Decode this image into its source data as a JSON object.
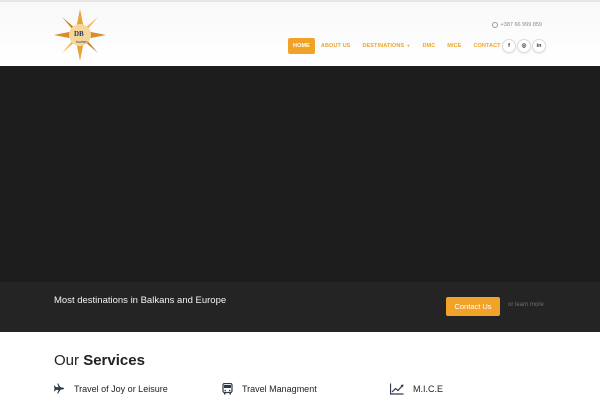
{
  "header": {
    "logo": {
      "letters": "DB",
      "subtitle": "tourism"
    },
    "phone": "+387 66 999 859",
    "nav": [
      {
        "label": "HOME"
      },
      {
        "label": "ABOUT US"
      },
      {
        "label": "DESTINATIONS"
      },
      {
        "label": "DMC"
      },
      {
        "label": "MICE"
      },
      {
        "label": "CONTACT US"
      }
    ],
    "social": [
      {
        "label": "f",
        "icon": "facebook-icon"
      },
      {
        "label": "◎",
        "icon": "instagram-icon"
      },
      {
        "label": "in",
        "icon": "linkedin-icon"
      }
    ]
  },
  "cta": {
    "text": "Most destinations in Balkans and Europe",
    "button": "Contact Us",
    "or_text": "or",
    "learn_more": "learn more"
  },
  "services": {
    "title_light": "Our",
    "title_bold": "Services",
    "items": [
      {
        "label": "Travel of Joy or Leisure",
        "icon": "airplane-icon"
      },
      {
        "label": "Travel Managment",
        "icon": "bus-icon"
      },
      {
        "label": "M.I.C.E",
        "icon": "chart-line-icon"
      }
    ]
  },
  "colors": {
    "accent": "#f0a328",
    "dark": "#1d1d1d",
    "navy": "#2a2f5a"
  }
}
